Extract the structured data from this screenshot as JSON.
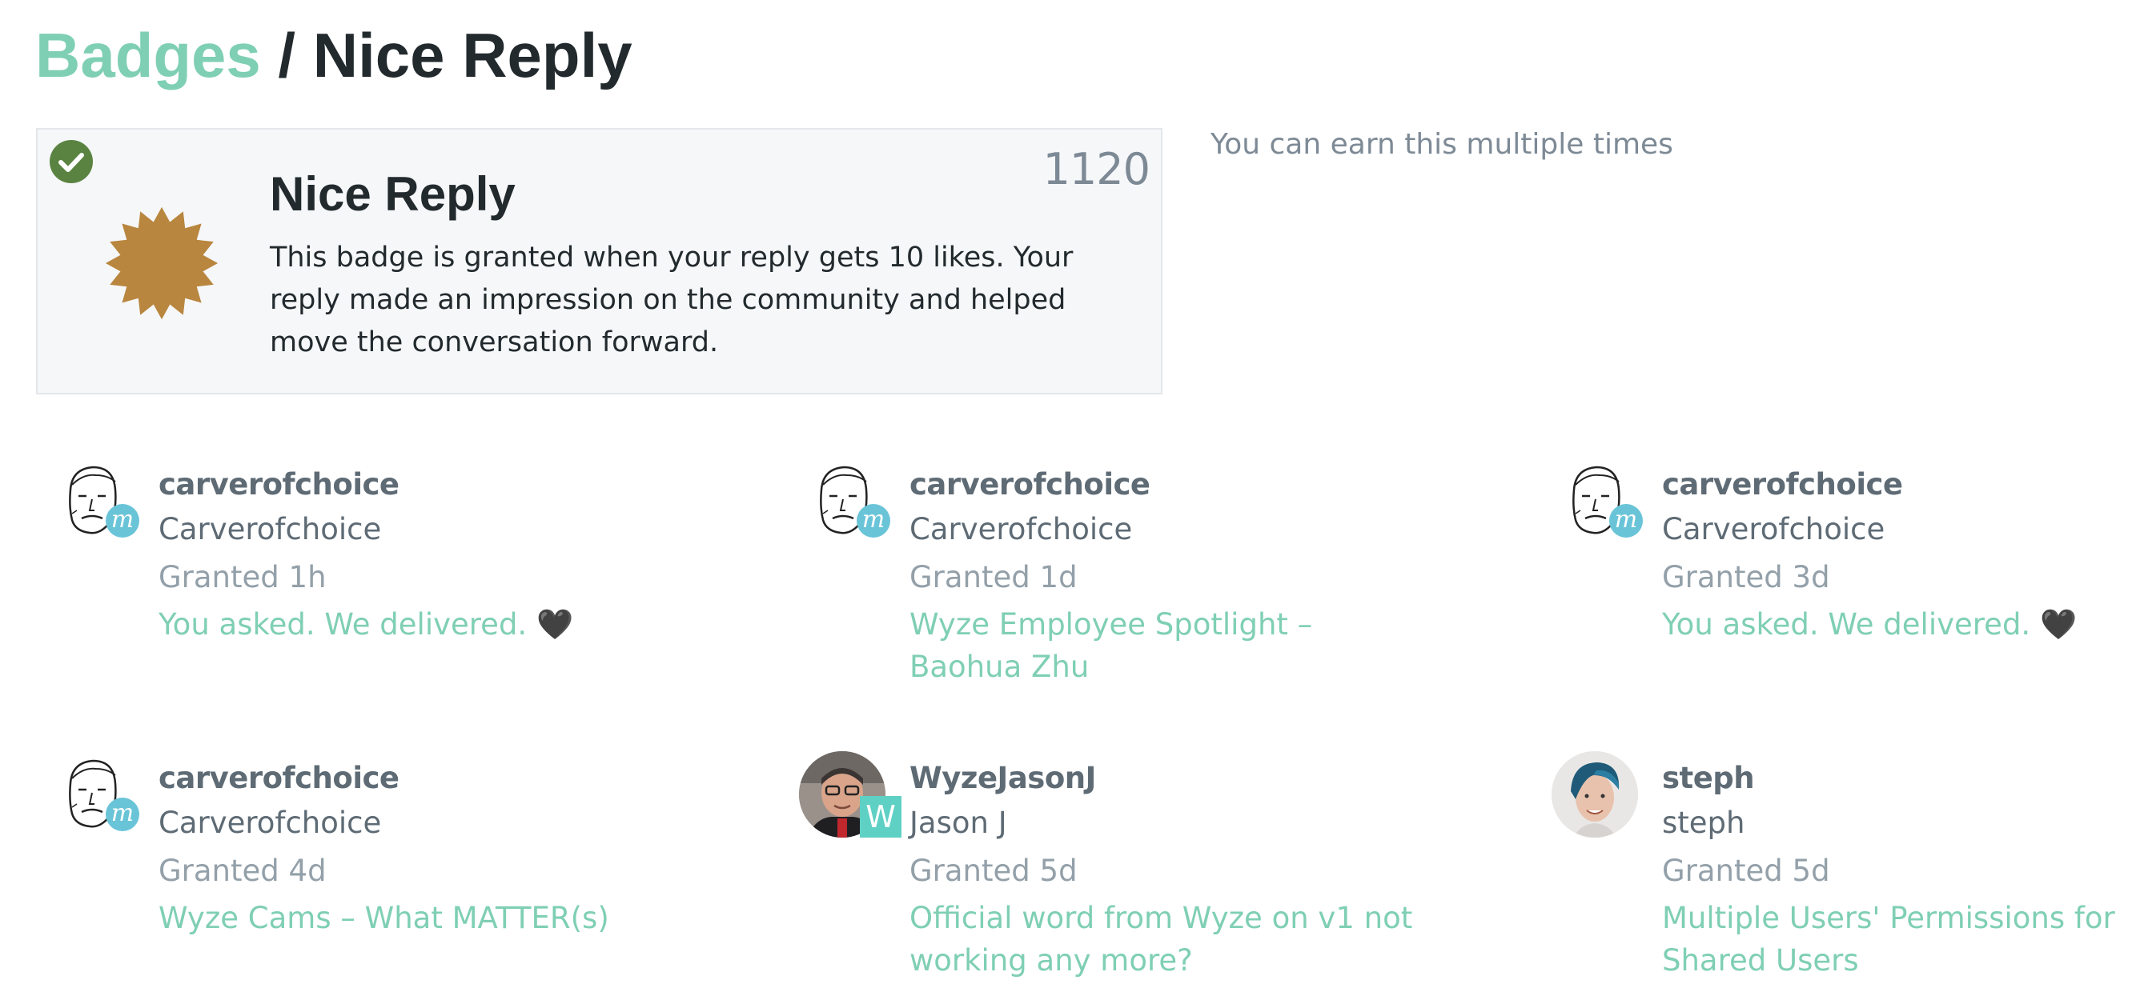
{
  "header": {
    "breadcrumb_link": "Badges",
    "separator": " / ",
    "current": "Nice Reply"
  },
  "badge": {
    "name": "Nice Reply",
    "count": "1120",
    "description": "This badge is granted when your reply gets 10 likes. Your reply made an impression on the community and helped move the conversation forward.",
    "note": "You can earn this multiple times",
    "colors": {
      "badge_icon": "#b8863e",
      "check": "#5a8341"
    },
    "icons": {
      "check": "check-circle-icon",
      "badge": "bronze-badge-icon"
    }
  },
  "grants": [
    {
      "username": "carverofchoice",
      "name": "Carverofchoice",
      "granted": "Granted 1h",
      "topic": "You asked. We delivered. 🖤",
      "flair": "m"
    },
    {
      "username": "carverofchoice",
      "name": "Carverofchoice",
      "granted": "Granted 1d",
      "topic": "Wyze Employee Spotlight – Baohua Zhu",
      "flair": "m"
    },
    {
      "username": "carverofchoice",
      "name": "Carverofchoice",
      "granted": "Granted 3d",
      "topic": "You asked. We delivered. 🖤",
      "flair": "m"
    },
    {
      "username": "carverofchoice",
      "name": "Carverofchoice",
      "granted": "Granted 4d",
      "topic": "Wyze Cams – What MATTER(s)",
      "flair": "m"
    },
    {
      "username": "WyzeJasonJ",
      "name": "Jason J",
      "granted": "Granted 5d",
      "topic": "Official word from Wyze on v1 not working any more?",
      "flair": "W"
    },
    {
      "username": "steph",
      "name": "steph",
      "granted": "Granted 5d",
      "topic": "Multiple Users' Permissions for Shared Users",
      "flair": ""
    }
  ],
  "colors": {
    "link": "#7fcfb4",
    "muted": "#93a0a9",
    "flair_m": "#6ac4d8",
    "flair_w": "#5fd0c4"
  }
}
